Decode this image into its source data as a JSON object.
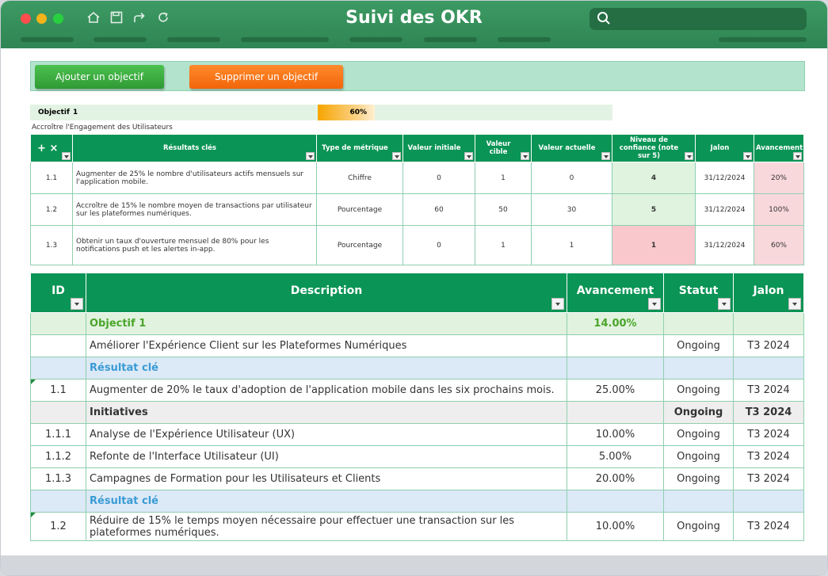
{
  "app": {
    "title": "Suivi des OKR",
    "search_placeholder": ""
  },
  "toolbar": {
    "add_label": "Ajouter un objectif",
    "delete_label": "Supprimer un objectif"
  },
  "objective": {
    "label": "Objectif",
    "number": "1",
    "progress_text": "60%",
    "progress": 0.6,
    "description": "Accroître l'Engagement des Utilisateurs"
  },
  "kr_table": {
    "add_icon": "+",
    "remove_icon": "×",
    "headers": [
      "Résultats clés",
      "Type de métrique",
      "Valeur initiale",
      "Valeur cible",
      "Valeur actuelle",
      "Niveau de confiance (note sur 5)",
      "Jalon",
      "Avancement"
    ],
    "rows": [
      {
        "id": "1.1",
        "desc": "Augmenter de 25% le nombre d'utilisateurs actifs mensuels sur l'application mobile.",
        "type": "Chiffre",
        "initial": "0",
        "target": "1",
        "current": "0",
        "confidence": "4",
        "milestone": "31/12/2024",
        "progress": "20%"
      },
      {
        "id": "1.2",
        "desc": "Accroître de 15% le nombre moyen de transactions par utilisateur sur les plateformes numériques.",
        "type": "Pourcentage",
        "initial": "60",
        "target": "50",
        "current": "30",
        "confidence": "5",
        "milestone": "31/12/2024",
        "progress": "100%"
      },
      {
        "id": "1.3",
        "desc": "Obtenir un taux d'ouverture mensuel de 80% pour les notifications push et les alertes in-app.",
        "type": "Pourcentage",
        "initial": "0",
        "target": "1",
        "current": "1",
        "confidence": "1",
        "milestone": "31/12/2024",
        "progress": "60%"
      }
    ]
  },
  "main_table": {
    "headers": [
      "ID",
      "Description",
      "Avancement",
      "Statut",
      "Jalon"
    ],
    "rows": [
      {
        "id": "",
        "desc": "Objectif 1",
        "progress": "14.00%",
        "status": "",
        "milestone": ""
      },
      {
        "id": "",
        "desc": "Améliorer l'Expérience Client sur les Plateformes Numériques",
        "progress": "",
        "status": "Ongoing",
        "milestone": "T3 2024"
      },
      {
        "id": "",
        "desc": "Résultat clé",
        "progress": "",
        "status": "",
        "milestone": ""
      },
      {
        "id": "1.1",
        "desc": "Augmenter de 20% le taux d'adoption de l'application mobile dans les six prochains mois.",
        "progress": "25.00%",
        "status": "Ongoing",
        "milestone": "T3 2024"
      },
      {
        "id": "",
        "desc": "Initiatives",
        "progress": "",
        "status": "Ongoing",
        "milestone": "T3 2024"
      },
      {
        "id": "1.1.1",
        "desc": "Analyse de l'Expérience Utilisateur (UX)",
        "progress": "10.00%",
        "status": "Ongoing",
        "milestone": "T3 2024"
      },
      {
        "id": "1.1.2",
        "desc": "Refonte de l'Interface Utilisateur (UI)",
        "progress": "5.00%",
        "status": "Ongoing",
        "milestone": "T3 2024"
      },
      {
        "id": "1.1.3",
        "desc": "Campagnes de Formation pour les Utilisateurs et Clients",
        "progress": "20.00%",
        "status": "Ongoing",
        "milestone": "T3 2024"
      },
      {
        "id": "",
        "desc": "Résultat clé",
        "progress": "",
        "status": "",
        "milestone": ""
      },
      {
        "id": "1.2",
        "desc": "Réduire de 15% le temps moyen nécessaire pour effectuer une transaction sur les plateformes numériques.",
        "progress": "10.00%",
        "status": "Ongoing",
        "milestone": "T3 2024"
      }
    ]
  },
  "colors": {
    "header_green": "#0a9455",
    "titlebar_green": "#2f8553",
    "add_button": "#3bb13f",
    "delete_button": "#f7731a",
    "confidence_low": "#f8c8cc",
    "confidence_high": "#dff3df"
  }
}
